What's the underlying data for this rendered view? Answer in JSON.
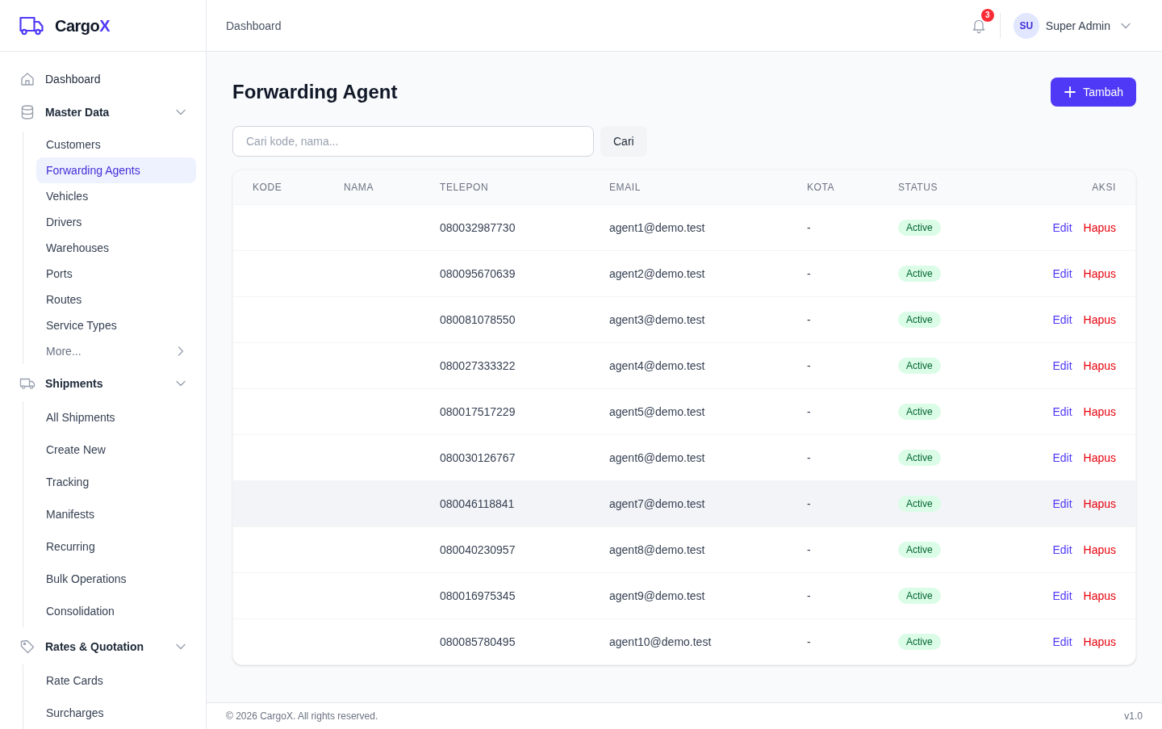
{
  "sidebar": {
    "logo": {
      "text": "Cargo",
      "accent": "X"
    },
    "items": [
      {
        "kind": "link",
        "label": "Dashboard",
        "selected": false
      },
      {
        "kind": "group",
        "label": "Master Data",
        "expanded": true,
        "children": [
          {
            "kind": "link",
            "label": "Customers",
            "selected": false
          },
          {
            "kind": "link",
            "label": "Forwarding Agents",
            "selected": true
          },
          {
            "kind": "link",
            "label": "Vehicles",
            "selected": false
          },
          {
            "kind": "link",
            "label": "Drivers",
            "selected": false
          },
          {
            "kind": "link",
            "label": "Warehouses",
            "selected": false
          },
          {
            "kind": "link",
            "label": "Ports",
            "selected": false
          },
          {
            "kind": "link",
            "label": "Routes",
            "selected": false
          },
          {
            "kind": "link",
            "label": "Service Types",
            "selected": false
          },
          {
            "kind": "more",
            "label": "More...",
            "selected": false
          }
        ]
      },
      {
        "kind": "group",
        "label": "Shipments",
        "expanded": true,
        "children": [
          {
            "kind": "link",
            "label": "All Shipments",
            "selected": false
          },
          {
            "kind": "link",
            "label": "Create New",
            "selected": false
          },
          {
            "kind": "link",
            "label": "Tracking",
            "selected": false
          },
          {
            "kind": "link",
            "label": "Manifests",
            "selected": false
          },
          {
            "kind": "link",
            "label": "Recurring",
            "selected": false
          },
          {
            "kind": "link",
            "label": "Bulk Operations",
            "selected": false
          },
          {
            "kind": "link",
            "label": "Consolidation",
            "selected": false
          }
        ]
      },
      {
        "kind": "group",
        "label": "Rates & Quotation",
        "expanded": true,
        "children": [
          {
            "kind": "link",
            "label": "Rate Cards",
            "selected": false
          },
          {
            "kind": "link",
            "label": "Surcharges",
            "selected": false
          }
        ]
      }
    ]
  },
  "header": {
    "breadcrumb": "Dashboard",
    "notifications": {
      "count": "3"
    },
    "user": {
      "initials": "SU",
      "name": "Super Admin"
    }
  },
  "page": {
    "title": "Forwarding Agent",
    "add_button": "Tambah",
    "search": {
      "placeholder": "Cari kode, nama...",
      "button": "Cari"
    }
  },
  "table": {
    "columns": [
      {
        "kind": "text",
        "label": "KODE"
      },
      {
        "kind": "text",
        "label": "NAMA"
      },
      {
        "kind": "text",
        "label": "TELEPON"
      },
      {
        "kind": "text",
        "label": "EMAIL"
      },
      {
        "kind": "text",
        "label": "KOTA"
      },
      {
        "kind": "status",
        "label": "STATUS"
      },
      {
        "kind": "actions",
        "label": "AKSI"
      }
    ],
    "rows": [
      {
        "telepon": "080032987730",
        "email": "agent1@demo.test",
        "kota": "-",
        "status": {
          "kind": "active",
          "label": "Active"
        },
        "actions": [
          {
            "kind": "edit",
            "label": "Edit"
          },
          {
            "kind": "delete",
            "label": "Hapus"
          }
        ],
        "hovered": false
      },
      {
        "telepon": "080095670639",
        "email": "agent2@demo.test",
        "kota": "-",
        "status": {
          "kind": "active",
          "label": "Active"
        },
        "actions": [
          {
            "kind": "edit",
            "label": "Edit"
          },
          {
            "kind": "delete",
            "label": "Hapus"
          }
        ],
        "hovered": false
      },
      {
        "telepon": "080081078550",
        "email": "agent3@demo.test",
        "kota": "-",
        "status": {
          "kind": "active",
          "label": "Active"
        },
        "actions": [
          {
            "kind": "edit",
            "label": "Edit"
          },
          {
            "kind": "delete",
            "label": "Hapus"
          }
        ],
        "hovered": false
      },
      {
        "telepon": "080027333322",
        "email": "agent4@demo.test",
        "kota": "-",
        "status": {
          "kind": "active",
          "label": "Active"
        },
        "actions": [
          {
            "kind": "edit",
            "label": "Edit"
          },
          {
            "kind": "delete",
            "label": "Hapus"
          }
        ],
        "hovered": false
      },
      {
        "telepon": "080017517229",
        "email": "agent5@demo.test",
        "kota": "-",
        "status": {
          "kind": "active",
          "label": "Active"
        },
        "actions": [
          {
            "kind": "edit",
            "label": "Edit"
          },
          {
            "kind": "delete",
            "label": "Hapus"
          }
        ],
        "hovered": false
      },
      {
        "telepon": "080030126767",
        "email": "agent6@demo.test",
        "kota": "-",
        "status": {
          "kind": "active",
          "label": "Active"
        },
        "actions": [
          {
            "kind": "edit",
            "label": "Edit"
          },
          {
            "kind": "delete",
            "label": "Hapus"
          }
        ],
        "hovered": false
      },
      {
        "telepon": "080046118841",
        "email": "agent7@demo.test",
        "kota": "-",
        "status": {
          "kind": "active",
          "label": "Active"
        },
        "actions": [
          {
            "kind": "edit",
            "label": "Edit"
          },
          {
            "kind": "delete",
            "label": "Hapus"
          }
        ],
        "hovered": true
      },
      {
        "telepon": "080040230957",
        "email": "agent8@demo.test",
        "kota": "-",
        "status": {
          "kind": "active",
          "label": "Active"
        },
        "actions": [
          {
            "kind": "edit",
            "label": "Edit"
          },
          {
            "kind": "delete",
            "label": "Hapus"
          }
        ],
        "hovered": false
      },
      {
        "telepon": "080016975345",
        "email": "agent9@demo.test",
        "kota": "-",
        "status": {
          "kind": "active",
          "label": "Active"
        },
        "actions": [
          {
            "kind": "edit",
            "label": "Edit"
          },
          {
            "kind": "delete",
            "label": "Hapus"
          }
        ],
        "hovered": false
      },
      {
        "telepon": "080085780495",
        "email": "agent10@demo.test",
        "kota": "-",
        "status": {
          "kind": "active",
          "label": "Active"
        },
        "actions": [
          {
            "kind": "edit",
            "label": "Edit"
          },
          {
            "kind": "delete",
            "label": "Hapus"
          }
        ],
        "hovered": false
      }
    ]
  },
  "footer": {
    "copyright": "© 2026 CargoX. All rights reserved.",
    "version": "v1.0"
  }
}
